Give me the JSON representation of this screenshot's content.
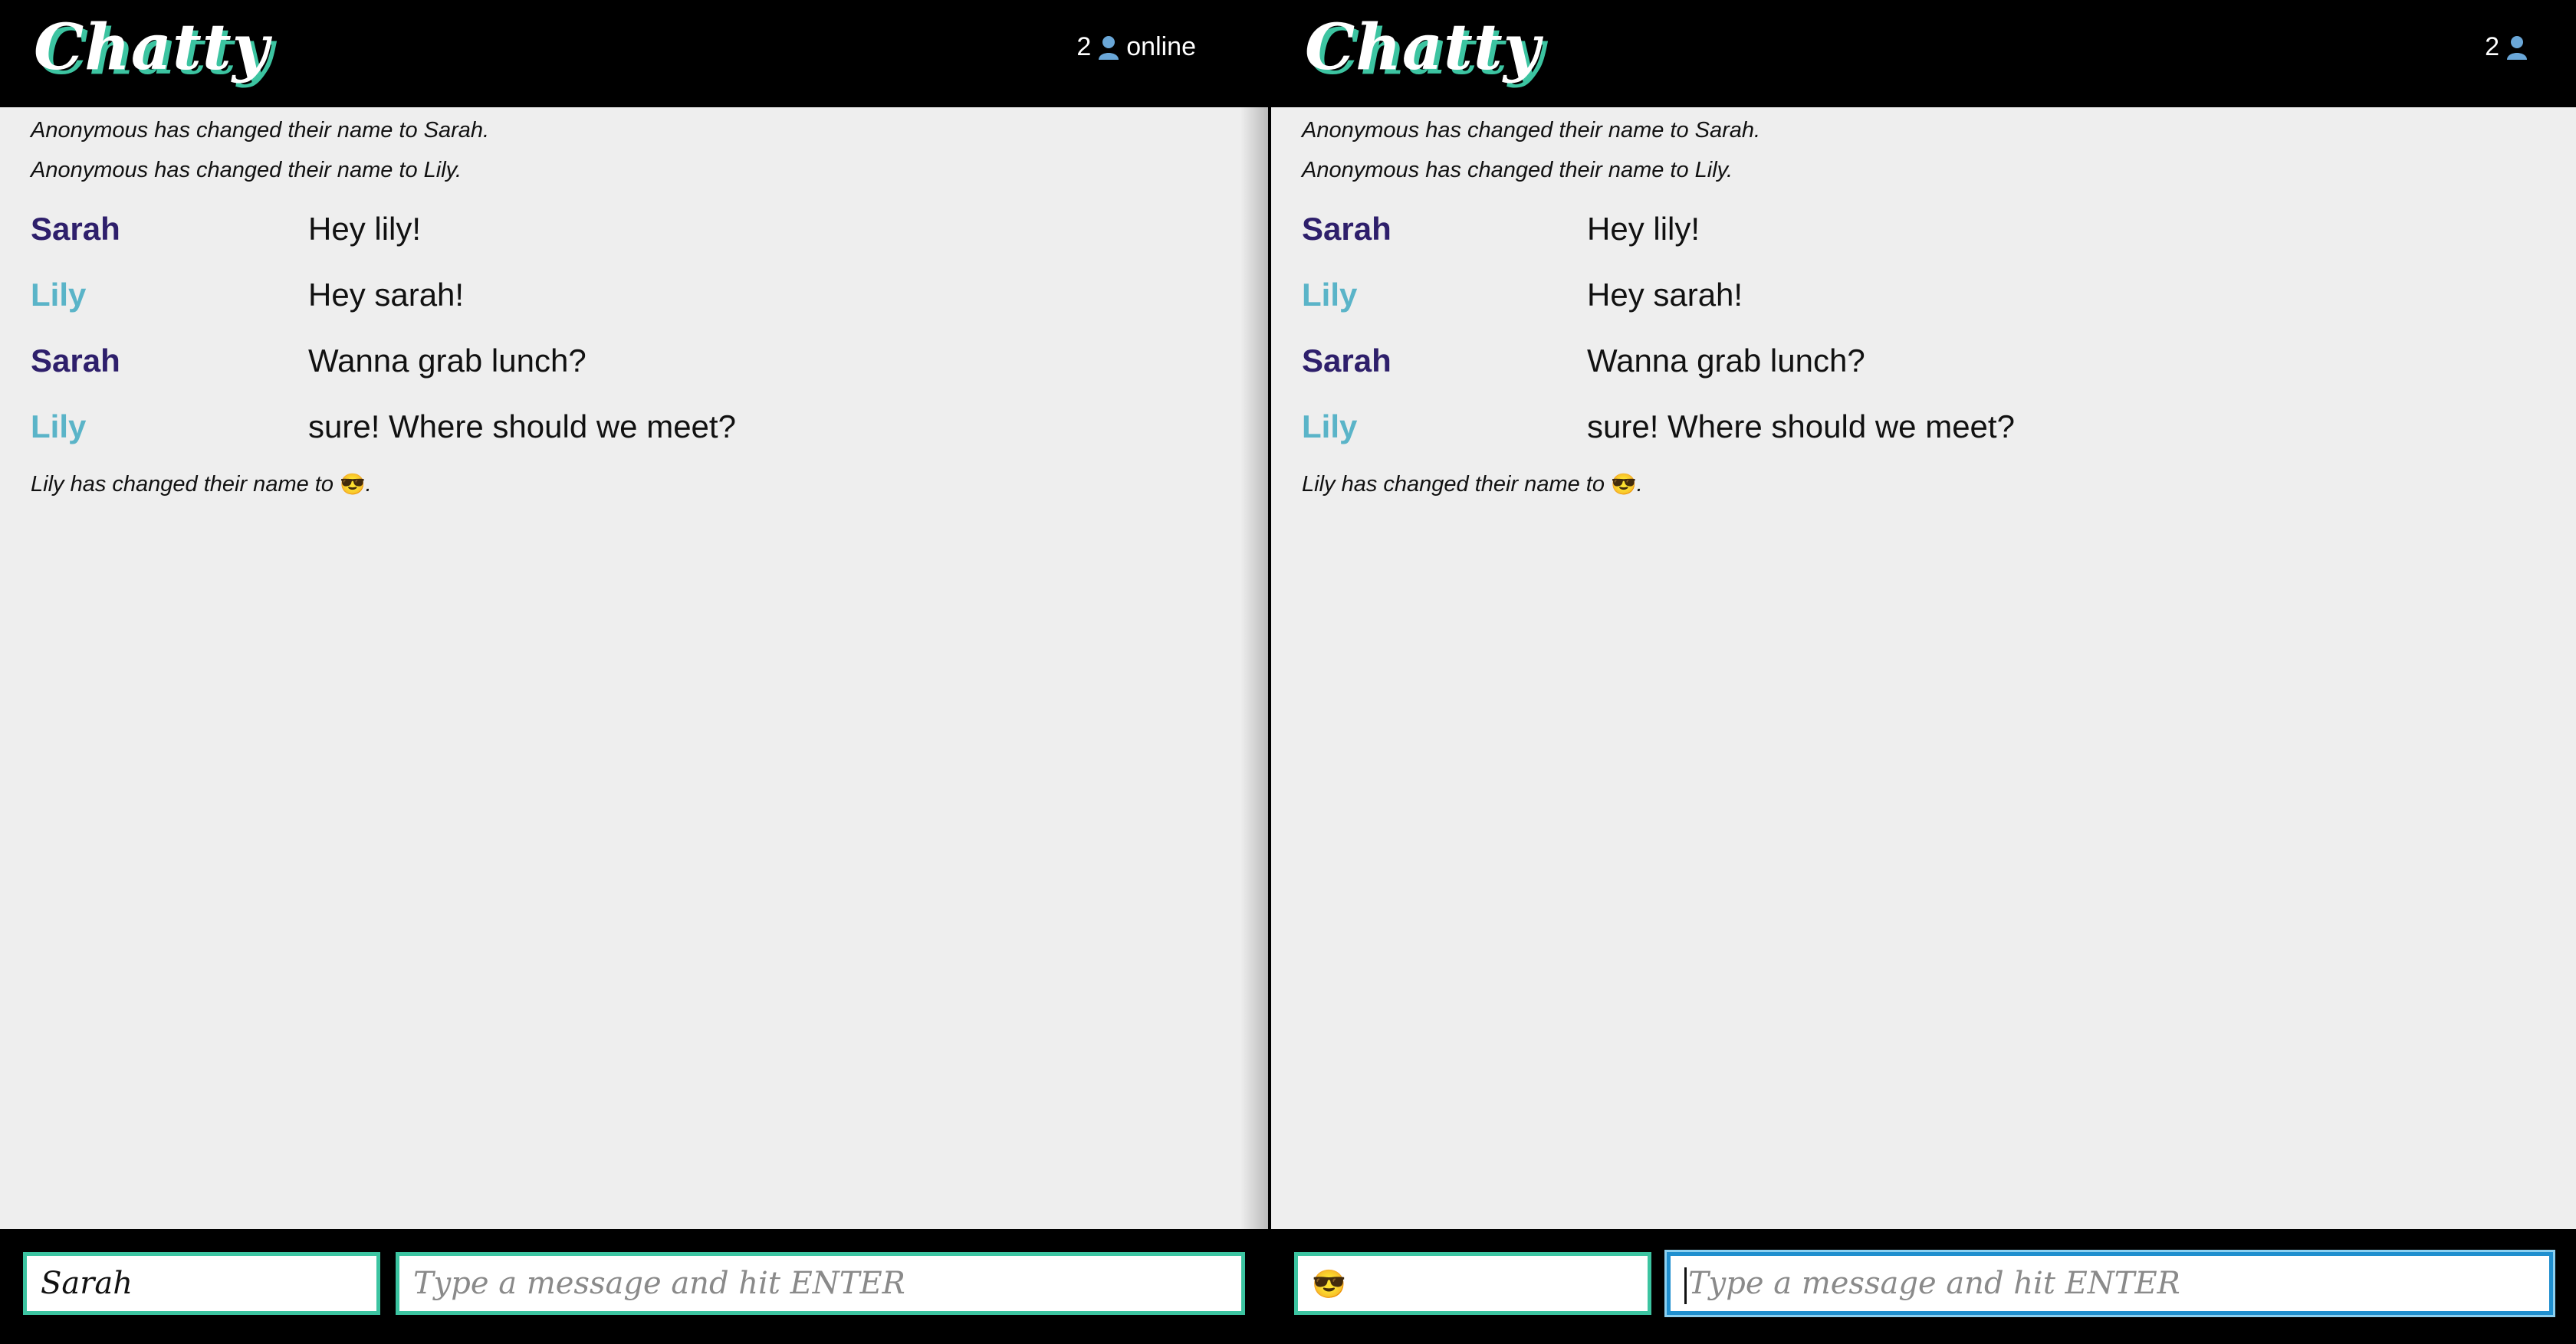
{
  "colors": {
    "header_bg": "#000000",
    "chat_bg": "#eeeeee",
    "logo_shadow": "#3cc4a1",
    "input_border": "#3cc4a1",
    "focused_input_border": "#1f8fcf",
    "sarah_color": "#2e1f6b",
    "lily_color": "#5ab4c8"
  },
  "left": {
    "logo": "Chatty",
    "online_count": "2",
    "online_label": "online",
    "user_icon": "user-icon",
    "messages": {
      "sys1": "Anonymous has changed their name to Sarah.",
      "sys2": "Anonymous has changed their name to Lily.",
      "m1_user": "Sarah",
      "m1_text": "Hey lily!",
      "m2_user": "Lily",
      "m2_text": "Hey sarah!",
      "m3_user": "Sarah",
      "m3_text": "Wanna grab lunch?",
      "m4_user": "Lily",
      "m4_text": "sure! Where should we meet?",
      "sys3": "Lily has changed their name to ",
      "sys3_emoji": "😎",
      "sys3_end": "."
    },
    "footer": {
      "name_value": "Sarah",
      "message_placeholder": "Type a message and hit ENTER"
    }
  },
  "right": {
    "logo": "Chatty",
    "online_count": "2",
    "user_icon": "user-icon",
    "messages": {
      "sys1": "Anonymous has changed their name to Sarah.",
      "sys2": "Anonymous has changed their name to Lily.",
      "m1_user": "Sarah",
      "m1_text": "Hey lily!",
      "m2_user": "Lily",
      "m2_text": "Hey sarah!",
      "m3_user": "Sarah",
      "m3_text": "Wanna grab lunch?",
      "m4_user": "Lily",
      "m4_text": "sure! Where should we meet?",
      "sys3": "Lily has changed their name to ",
      "sys3_emoji": "😎",
      "sys3_end": "."
    },
    "footer": {
      "name_value": "😎",
      "message_placeholder": "Type a message and hit ENTER"
    }
  }
}
